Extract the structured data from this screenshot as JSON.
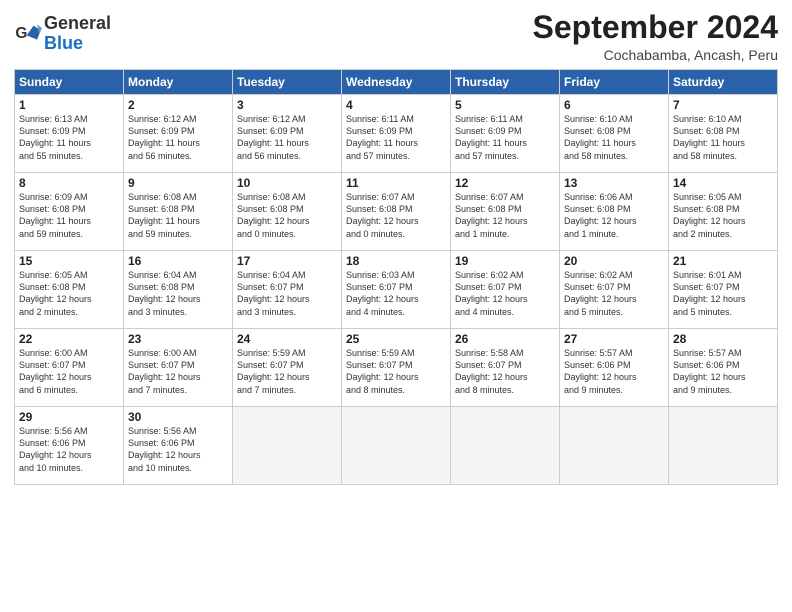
{
  "header": {
    "logo_line1": "General",
    "logo_line2": "Blue",
    "month_title": "September 2024",
    "subtitle": "Cochabamba, Ancash, Peru"
  },
  "weekdays": [
    "Sunday",
    "Monday",
    "Tuesday",
    "Wednesday",
    "Thursday",
    "Friday",
    "Saturday"
  ],
  "weeks": [
    [
      {
        "day": "1",
        "info": "Sunrise: 6:13 AM\nSunset: 6:09 PM\nDaylight: 11 hours\nand 55 minutes."
      },
      {
        "day": "2",
        "info": "Sunrise: 6:12 AM\nSunset: 6:09 PM\nDaylight: 11 hours\nand 56 minutes."
      },
      {
        "day": "3",
        "info": "Sunrise: 6:12 AM\nSunset: 6:09 PM\nDaylight: 11 hours\nand 56 minutes."
      },
      {
        "day": "4",
        "info": "Sunrise: 6:11 AM\nSunset: 6:09 PM\nDaylight: 11 hours\nand 57 minutes."
      },
      {
        "day": "5",
        "info": "Sunrise: 6:11 AM\nSunset: 6:09 PM\nDaylight: 11 hours\nand 57 minutes."
      },
      {
        "day": "6",
        "info": "Sunrise: 6:10 AM\nSunset: 6:08 PM\nDaylight: 11 hours\nand 58 minutes."
      },
      {
        "day": "7",
        "info": "Sunrise: 6:10 AM\nSunset: 6:08 PM\nDaylight: 11 hours\nand 58 minutes."
      }
    ],
    [
      {
        "day": "8",
        "info": "Sunrise: 6:09 AM\nSunset: 6:08 PM\nDaylight: 11 hours\nand 59 minutes."
      },
      {
        "day": "9",
        "info": "Sunrise: 6:08 AM\nSunset: 6:08 PM\nDaylight: 11 hours\nand 59 minutes."
      },
      {
        "day": "10",
        "info": "Sunrise: 6:08 AM\nSunset: 6:08 PM\nDaylight: 12 hours\nand 0 minutes."
      },
      {
        "day": "11",
        "info": "Sunrise: 6:07 AM\nSunset: 6:08 PM\nDaylight: 12 hours\nand 0 minutes."
      },
      {
        "day": "12",
        "info": "Sunrise: 6:07 AM\nSunset: 6:08 PM\nDaylight: 12 hours\nand 1 minute."
      },
      {
        "day": "13",
        "info": "Sunrise: 6:06 AM\nSunset: 6:08 PM\nDaylight: 12 hours\nand 1 minute."
      },
      {
        "day": "14",
        "info": "Sunrise: 6:05 AM\nSunset: 6:08 PM\nDaylight: 12 hours\nand 2 minutes."
      }
    ],
    [
      {
        "day": "15",
        "info": "Sunrise: 6:05 AM\nSunset: 6:08 PM\nDaylight: 12 hours\nand 2 minutes."
      },
      {
        "day": "16",
        "info": "Sunrise: 6:04 AM\nSunset: 6:08 PM\nDaylight: 12 hours\nand 3 minutes."
      },
      {
        "day": "17",
        "info": "Sunrise: 6:04 AM\nSunset: 6:07 PM\nDaylight: 12 hours\nand 3 minutes."
      },
      {
        "day": "18",
        "info": "Sunrise: 6:03 AM\nSunset: 6:07 PM\nDaylight: 12 hours\nand 4 minutes."
      },
      {
        "day": "19",
        "info": "Sunrise: 6:02 AM\nSunset: 6:07 PM\nDaylight: 12 hours\nand 4 minutes."
      },
      {
        "day": "20",
        "info": "Sunrise: 6:02 AM\nSunset: 6:07 PM\nDaylight: 12 hours\nand 5 minutes."
      },
      {
        "day": "21",
        "info": "Sunrise: 6:01 AM\nSunset: 6:07 PM\nDaylight: 12 hours\nand 5 minutes."
      }
    ],
    [
      {
        "day": "22",
        "info": "Sunrise: 6:00 AM\nSunset: 6:07 PM\nDaylight: 12 hours\nand 6 minutes."
      },
      {
        "day": "23",
        "info": "Sunrise: 6:00 AM\nSunset: 6:07 PM\nDaylight: 12 hours\nand 7 minutes."
      },
      {
        "day": "24",
        "info": "Sunrise: 5:59 AM\nSunset: 6:07 PM\nDaylight: 12 hours\nand 7 minutes."
      },
      {
        "day": "25",
        "info": "Sunrise: 5:59 AM\nSunset: 6:07 PM\nDaylight: 12 hours\nand 8 minutes."
      },
      {
        "day": "26",
        "info": "Sunrise: 5:58 AM\nSunset: 6:07 PM\nDaylight: 12 hours\nand 8 minutes."
      },
      {
        "day": "27",
        "info": "Sunrise: 5:57 AM\nSunset: 6:06 PM\nDaylight: 12 hours\nand 9 minutes."
      },
      {
        "day": "28",
        "info": "Sunrise: 5:57 AM\nSunset: 6:06 PM\nDaylight: 12 hours\nand 9 minutes."
      }
    ],
    [
      {
        "day": "29",
        "info": "Sunrise: 5:56 AM\nSunset: 6:06 PM\nDaylight: 12 hours\nand 10 minutes."
      },
      {
        "day": "30",
        "info": "Sunrise: 5:56 AM\nSunset: 6:06 PM\nDaylight: 12 hours\nand 10 minutes."
      },
      null,
      null,
      null,
      null,
      null
    ]
  ]
}
